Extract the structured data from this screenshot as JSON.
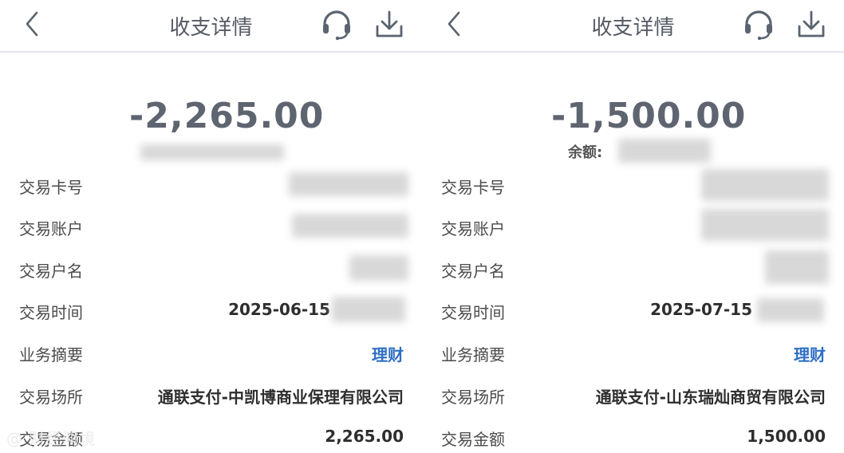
{
  "left": {
    "header": {
      "title": "收支详情"
    },
    "amount": "-2,265.00",
    "balance_label": "",
    "rows": [
      {
        "label": "交易卡号",
        "value": ""
      },
      {
        "label": "交易账户",
        "value": ""
      },
      {
        "label": "交易户名",
        "value": ""
      },
      {
        "label": "交易时间",
        "value": "2025-06-15"
      },
      {
        "label": "业务摘要",
        "value": "理财"
      },
      {
        "label": "交易场所",
        "value": "通联支付-中凯博商业保理有限公司"
      },
      {
        "label": "交易金额",
        "value": "2,265.00"
      }
    ]
  },
  "right": {
    "header": {
      "title": "收支详情"
    },
    "amount": "-1,500.00",
    "balance_label": "余额:",
    "rows": [
      {
        "label": "交易卡号",
        "value": ""
      },
      {
        "label": "交易账户",
        "value": ""
      },
      {
        "label": "交易户名",
        "value": ""
      },
      {
        "label": "交易时间",
        "value": "2025-07-15"
      },
      {
        "label": "业务摘要",
        "value": "理财"
      },
      {
        "label": "交易场所",
        "value": "通联支付-山东瑞灿商贸有限公司"
      },
      {
        "label": "交易金额",
        "value": "1,500.00"
      }
    ]
  },
  "watermark": "@ 财经鸿境",
  "colors": {
    "link": "#2f6fc4",
    "amount": "#5e6470",
    "icon": "#5b6470"
  },
  "icons": [
    "chevron-left-icon",
    "headset-icon",
    "download-icon"
  ]
}
